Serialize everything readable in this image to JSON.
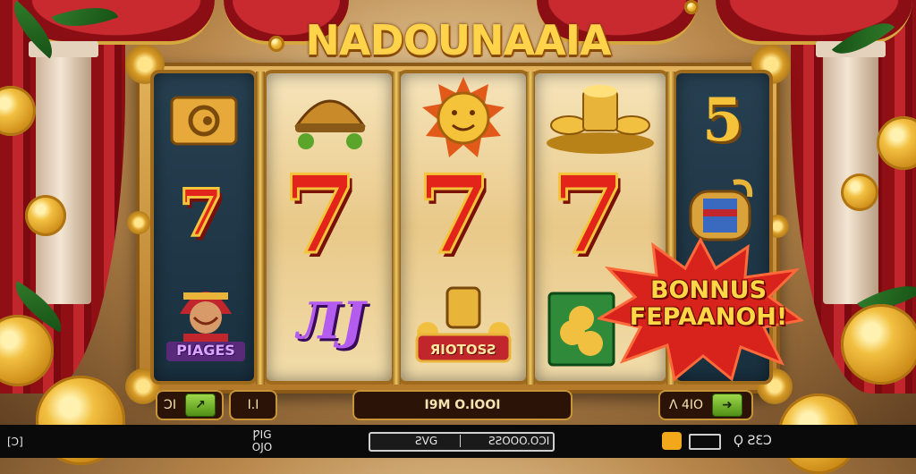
{
  "title": "NADOUNAAIA",
  "reels": {
    "reel1": {
      "symbols": [
        "scroll",
        "7",
        "heroine"
      ],
      "label": "PIAGES"
    },
    "reel2": {
      "symbols": [
        "helmet",
        "7",
        "7"
      ],
      "label": "ЛЈ"
    },
    "reel3": {
      "symbols": [
        "sun-face",
        "7",
        "treasure"
      ],
      "label": "ЯIOTOSƧ"
    },
    "reel4": {
      "symbols": [
        "coin-stack",
        "7",
        "money"
      ]
    },
    "reel5": {
      "symbols": [
        "5",
        "fabric-roll"
      ],
      "label": "5"
    },
    "seven": "7"
  },
  "bonus": {
    "line1": "BONNUS",
    "line2": "FEPAANOH!"
  },
  "controls": {
    "left_label": "ƆI",
    "left_arrow": "↗",
    "line_display": "I.I",
    "center_display": "I9M O.IOOI",
    "right_label": "Λ 4IO",
    "right_arrow": "➜"
  },
  "bottom_bar": {
    "left": "[Ɔ]",
    "stack_top": "ǷIG",
    "stack_bottom": "OJO",
    "progress_left": "ƧVG",
    "progress_right": "ƧƧOOO.OƆI",
    "right_label": "Ϙ ƧƐƆ"
  },
  "colors": {
    "accent": "#ffd34a",
    "reel_dark": "#274051",
    "curtain": "#c0262c"
  }
}
